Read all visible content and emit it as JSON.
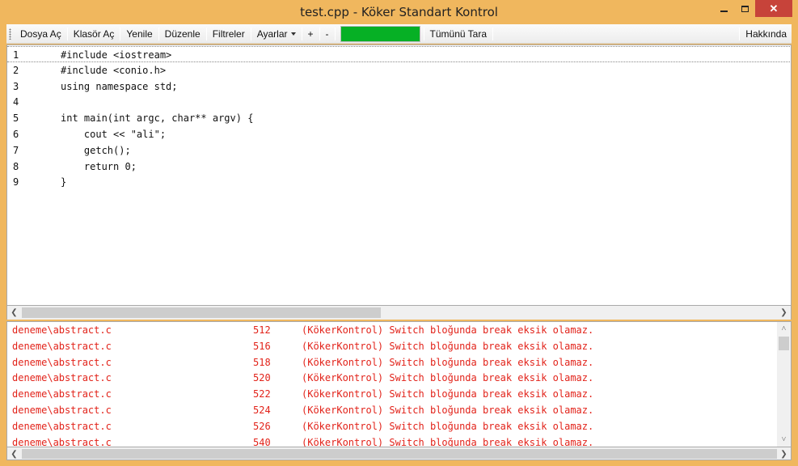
{
  "window": {
    "title": "test.cpp - Köker Standart Kontrol",
    "close_label": "✕"
  },
  "toolbar": {
    "open_file": "Dosya Aç",
    "open_folder": "Klasör Aç",
    "refresh": "Yenile",
    "edit": "Düzenle",
    "filters": "Filtreler",
    "settings": "Ayarlar",
    "zoom_in": "+",
    "zoom_out": "-",
    "scan_all": "Tümünü Tara",
    "about": "Hakkında",
    "progress_color": "#06b025"
  },
  "editor": {
    "lines": [
      {
        "num": "1",
        "text": "#include <iostream>"
      },
      {
        "num": "2",
        "text": "#include <conio.h>"
      },
      {
        "num": "3",
        "text": "using namespace std;"
      },
      {
        "num": "4",
        "text": ""
      },
      {
        "num": "5",
        "text": "int main(int argc, char** argv) {"
      },
      {
        "num": "6",
        "text": "    cout << \"ali\";"
      },
      {
        "num": "7",
        "text": "    getch();"
      },
      {
        "num": "8",
        "text": "    return 0;"
      },
      {
        "num": "9",
        "text": "}"
      }
    ]
  },
  "results": {
    "text_color": "#e2231a",
    "rows": [
      {
        "file": "deneme\\abstract.c",
        "line": "512",
        "message": "(KökerKontrol) Switch bloğunda break eksik olamaz."
      },
      {
        "file": "deneme\\abstract.c",
        "line": "516",
        "message": "(KökerKontrol) Switch bloğunda break eksik olamaz."
      },
      {
        "file": "deneme\\abstract.c",
        "line": "518",
        "message": "(KökerKontrol) Switch bloğunda break eksik olamaz."
      },
      {
        "file": "deneme\\abstract.c",
        "line": "520",
        "message": "(KökerKontrol) Switch bloğunda break eksik olamaz."
      },
      {
        "file": "deneme\\abstract.c",
        "line": "522",
        "message": "(KökerKontrol) Switch bloğunda break eksik olamaz."
      },
      {
        "file": "deneme\\abstract.c",
        "line": "524",
        "message": "(KökerKontrol) Switch bloğunda break eksik olamaz."
      },
      {
        "file": "deneme\\abstract.c",
        "line": "526",
        "message": "(KökerKontrol) Switch bloğunda break eksik olamaz."
      },
      {
        "file": "deneme\\abstract.c",
        "line": "540",
        "message": "(KökerKontrol) Switch bloğunda break eksik olamaz."
      }
    ]
  }
}
